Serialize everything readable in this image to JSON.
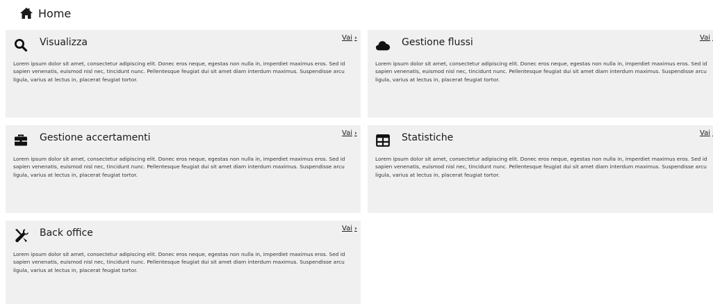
{
  "breadcrumb": {
    "home_label": "Home",
    "icon": "home-icon"
  },
  "cards": [
    {
      "title": "Visualizza",
      "icon": "search-icon",
      "link_label": "Vai",
      "description": "Lorem ipsum dolor sit amet, consectetur adipiscing elit. Donec eros neque, egestas non nulla in, imperdiet maximus eros. Sed id sapien venenatis, euismod nisl nec, tincidunt nunc. Pellentesque feugiat dui sit amet diam interdum maximus. Suspendisse arcu ligula, varius at lectus in, placerat feugiat tortor."
    },
    {
      "title": "Gestione flussi",
      "icon": "cloud-icon",
      "link_label": "Vai",
      "description": "Lorem ipsum dolor sit amet, consectetur adipiscing elit. Donec eros neque, egestas non nulla in, imperdiet maximus eros. Sed id sapien venenatis, euismod nisl nec, tincidunt nunc. Pellentesque feugiat dui sit amet diam interdum maximus. Suspendisse arcu ligula, varius at lectus in, placerat feugiat tortor."
    },
    {
      "title": "Gestione accertamenti",
      "icon": "briefcase-icon",
      "link_label": "Vai",
      "description": "Lorem ipsum dolor sit amet, consectetur adipiscing elit. Donec eros neque, egestas non nulla in, imperdiet maximus eros. Sed id sapien venenatis, euismod nisl nec, tincidunt nunc. Pellentesque feugiat dui sit amet diam interdum maximus. Suspendisse arcu ligula, varius at lectus in, placerat feugiat tortor."
    },
    {
      "title": "Statistiche",
      "icon": "table-icon",
      "link_label": "Vai",
      "description": "Lorem ipsum dolor sit amet, consectetur adipiscing elit. Donec eros neque, egestas non nulla in, imperdiet maximus eros. Sed id sapien venenatis, euismod nisl nec, tincidunt nunc. Pellentesque feugiat dui sit amet diam interdum maximus. Suspendisse arcu ligula, varius at lectus in, placerat feugiat tortor."
    },
    {
      "title": "Back office",
      "icon": "tools-icon",
      "link_label": "Vai",
      "description": "Lorem ipsum dolor sit amet, consectetur adipiscing elit. Donec eros neque, egestas non nulla in, imperdiet maximus eros. Sed id sapien venenatis, euismod nisl nec, tincidunt nunc. Pellentesque feugiat dui sit amet diam interdum maximus. Suspendisse arcu ligula, varius at lectus in, placerat feugiat tortor."
    }
  ],
  "colors": {
    "card_background": "#f0f0f0",
    "text": "#1a1a1a"
  }
}
